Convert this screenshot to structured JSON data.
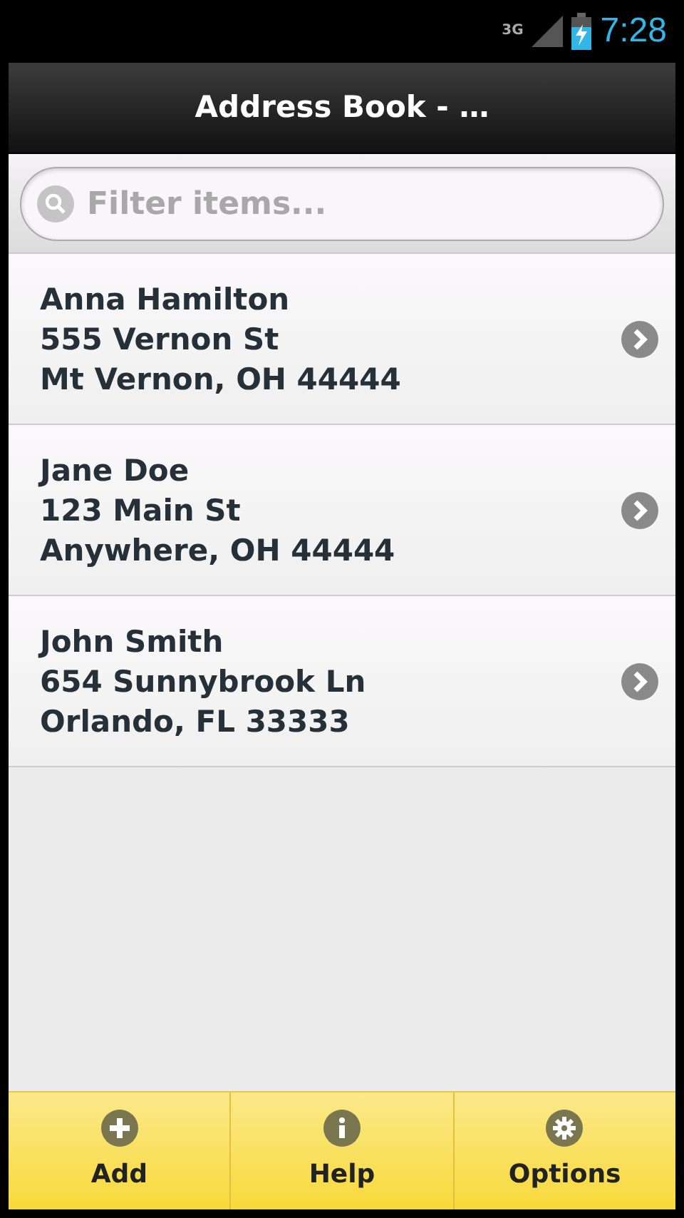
{
  "status_bar": {
    "network": "3G",
    "time": "7:28"
  },
  "header": {
    "title": "Address Book - …"
  },
  "search": {
    "placeholder": "Filter items..."
  },
  "contacts": [
    {
      "name": "Anna Hamilton",
      "street": "555 Vernon St",
      "city": "Mt Vernon, OH 44444"
    },
    {
      "name": "Jane Doe",
      "street": "123 Main St",
      "city": "Anywhere, OH 44444"
    },
    {
      "name": "John Smith",
      "street": "654 Sunnybrook Ln",
      "city": "Orlando, FL 33333"
    }
  ],
  "footer_tabs": [
    {
      "kind": "add",
      "label": "Add"
    },
    {
      "kind": "help",
      "label": "Help"
    },
    {
      "kind": "options",
      "label": "Options"
    }
  ]
}
